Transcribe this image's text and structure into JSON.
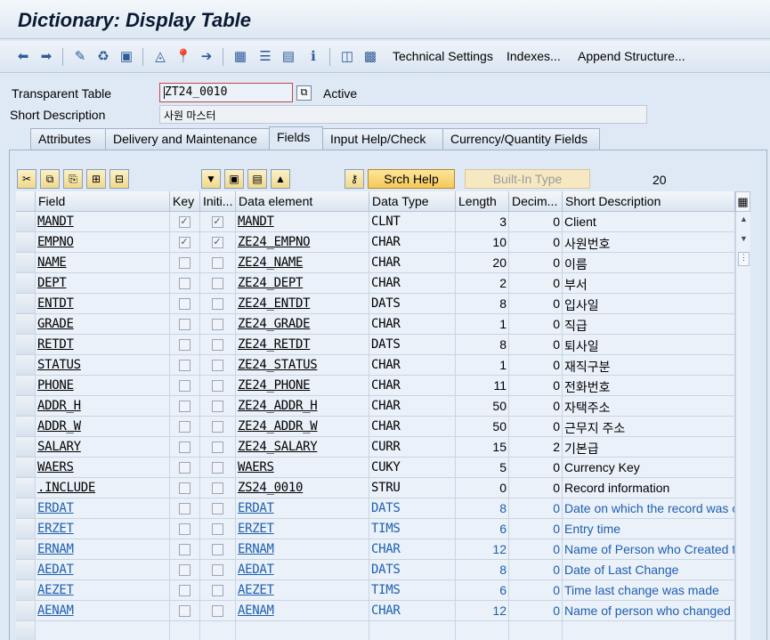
{
  "window": {
    "title": "Dictionary: Display Table"
  },
  "toolbar": {
    "icons": [
      "back-arrow-icon",
      "forward-arrow-icon",
      "display-change-icon",
      "other-object-icon",
      "activate-icon",
      "where-used-icon",
      "pin-icon",
      "navigate-icon",
      "hierarchy-icon",
      "stack-icon",
      "list-icon",
      "info-icon",
      "table-structure-icon",
      "contents-icon"
    ],
    "technical_settings": "Technical Settings",
    "indexes": "Indexes...",
    "append_structure": "Append Structure..."
  },
  "header": {
    "table_label": "Transparent Table",
    "table_value": "ZT24_0010",
    "status": "Active",
    "short_desc_label": "Short Description",
    "short_desc_value": "사원 마스터"
  },
  "tabs": [
    {
      "label": "Attributes",
      "active": false
    },
    {
      "label": "Delivery and Maintenance",
      "active": false
    },
    {
      "label": "Fields",
      "active": true
    },
    {
      "label": "Input Help/Check",
      "active": false
    },
    {
      "label": "Currency/Quantity Fields",
      "active": false
    }
  ],
  "grid_toolbar": {
    "srch_help": "Srch Help",
    "builtin_type": "Built-In Type",
    "count": "20"
  },
  "columns": [
    "Field",
    "Key",
    "Initi...",
    "Data element",
    "Data Type",
    "Length",
    "Decim...",
    "Short Description"
  ],
  "rows": [
    {
      "field": "MANDT",
      "key": true,
      "init": true,
      "element": "MANDT",
      "type": "CLNT",
      "length": "3",
      "dec": "0",
      "desc": "Client",
      "blue": false
    },
    {
      "field": "EMPNO",
      "key": true,
      "init": true,
      "element": "ZE24_EMPNO",
      "type": "CHAR",
      "length": "10",
      "dec": "0",
      "desc": "사원번호",
      "blue": false
    },
    {
      "field": "NAME",
      "key": false,
      "init": false,
      "element": "ZE24_NAME",
      "type": "CHAR",
      "length": "20",
      "dec": "0",
      "desc": "이름",
      "blue": false
    },
    {
      "field": "DEPT",
      "key": false,
      "init": false,
      "element": "ZE24_DEPT",
      "type": "CHAR",
      "length": "2",
      "dec": "0",
      "desc": "부서",
      "blue": false
    },
    {
      "field": "ENTDT",
      "key": false,
      "init": false,
      "element": "ZE24_ENTDT",
      "type": "DATS",
      "length": "8",
      "dec": "0",
      "desc": "입사일",
      "blue": false
    },
    {
      "field": "GRADE",
      "key": false,
      "init": false,
      "element": "ZE24_GRADE",
      "type": "CHAR",
      "length": "1",
      "dec": "0",
      "desc": "직급",
      "blue": false
    },
    {
      "field": "RETDT",
      "key": false,
      "init": false,
      "element": "ZE24_RETDT",
      "type": "DATS",
      "length": "8",
      "dec": "0",
      "desc": "퇴사일",
      "blue": false
    },
    {
      "field": "STATUS",
      "key": false,
      "init": false,
      "element": "ZE24_STATUS",
      "type": "CHAR",
      "length": "1",
      "dec": "0",
      "desc": "재직구분",
      "blue": false
    },
    {
      "field": "PHONE",
      "key": false,
      "init": false,
      "element": "ZE24_PHONE",
      "type": "CHAR",
      "length": "11",
      "dec": "0",
      "desc": "전화번호",
      "blue": false
    },
    {
      "field": "ADDR_H",
      "key": false,
      "init": false,
      "element": "ZE24_ADDR_H",
      "type": "CHAR",
      "length": "50",
      "dec": "0",
      "desc": "자택주소",
      "blue": false
    },
    {
      "field": "ADDR_W",
      "key": false,
      "init": false,
      "element": "ZE24_ADDR_W",
      "type": "CHAR",
      "length": "50",
      "dec": "0",
      "desc": "근무지 주소",
      "blue": false
    },
    {
      "field": "SALARY",
      "key": false,
      "init": false,
      "element": "ZE24_SALARY",
      "type": "CURR",
      "length": "15",
      "dec": "2",
      "desc": "기본급",
      "blue": false
    },
    {
      "field": "WAERS",
      "key": false,
      "init": false,
      "element": "WAERS",
      "type": "CUKY",
      "length": "5",
      "dec": "0",
      "desc": "Currency Key",
      "blue": false
    },
    {
      "field": ".INCLUDE",
      "key": false,
      "init": false,
      "element": "ZS24_0010",
      "type": "STRU",
      "length": "0",
      "dec": "0",
      "desc": "Record information",
      "blue": false
    },
    {
      "field": "ERDAT",
      "key": false,
      "init": false,
      "element": "ERDAT",
      "type": "DATS",
      "length": "8",
      "dec": "0",
      "desc": "Date on which the record was c",
      "blue": true
    },
    {
      "field": "ERZET",
      "key": false,
      "init": false,
      "element": "ERZET",
      "type": "TIMS",
      "length": "6",
      "dec": "0",
      "desc": "Entry time",
      "blue": true
    },
    {
      "field": "ERNAM",
      "key": false,
      "init": false,
      "element": "ERNAM",
      "type": "CHAR",
      "length": "12",
      "dec": "0",
      "desc": "Name of Person who Created t",
      "blue": true
    },
    {
      "field": "AEDAT",
      "key": false,
      "init": false,
      "element": "AEDAT",
      "type": "DATS",
      "length": "8",
      "dec": "0",
      "desc": "Date of Last Change",
      "blue": true
    },
    {
      "field": "AEZET",
      "key": false,
      "init": false,
      "element": "AEZET",
      "type": "TIMS",
      "length": "6",
      "dec": "0",
      "desc": "Time last change was made",
      "blue": true
    },
    {
      "field": "AENAM",
      "key": false,
      "init": false,
      "element": "AENAM",
      "type": "CHAR",
      "length": "12",
      "dec": "0",
      "desc": "Name of person who changed c",
      "blue": true
    }
  ]
}
